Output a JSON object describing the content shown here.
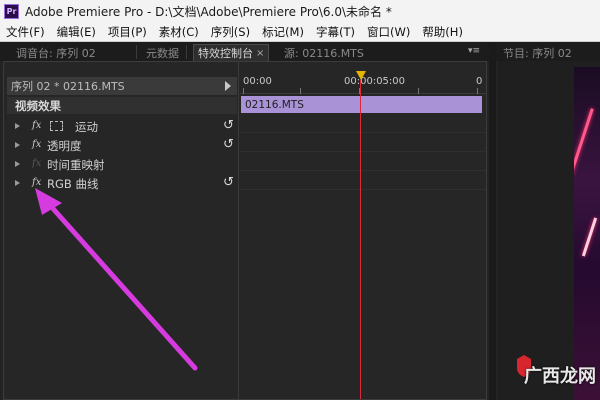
{
  "window": {
    "app_icon_text": "Pr",
    "title": "Adobe Premiere Pro - D:\\文档\\Adobe\\Premiere Pro\\6.0\\未命名 *"
  },
  "menu": {
    "items": [
      "文件(F)",
      "编辑(E)",
      "项目(P)",
      "素材(C)",
      "序列(S)",
      "标记(M)",
      "字幕(T)",
      "窗口(W)",
      "帮助(H)"
    ]
  },
  "tabs": {
    "mixer": "调音台: 序列 02",
    "metadata": "元数据",
    "effect_controls": "特效控制台",
    "source": "源: 02116.MTS",
    "program": "节目: 序列 02"
  },
  "effect_controls": {
    "sequence_clip": "序列 02 * 02116.MTS",
    "section_title": "视频效果",
    "effects": [
      {
        "label": "运动",
        "fx_enabled": true,
        "has_reset": true
      },
      {
        "label": "透明度",
        "fx_enabled": true,
        "has_reset": true
      },
      {
        "label": "时间重映射",
        "fx_enabled": false,
        "has_reset": false
      },
      {
        "label": "RGB 曲线",
        "fx_enabled": true,
        "has_reset": true
      }
    ],
    "fx_glyph": "fx",
    "reset_glyph": "↺"
  },
  "timeline": {
    "start_tc": "00:00",
    "mid_tc": "00:00:05:00",
    "end_tc": "0",
    "clip_name": "02116.MTS"
  },
  "colors": {
    "clip": "#a992d6",
    "playhead": "#e0283a",
    "playhead_marker": "#e8b400",
    "annotation_arrow": "#d63be0"
  },
  "watermark": {
    "text": "广西龙网"
  }
}
